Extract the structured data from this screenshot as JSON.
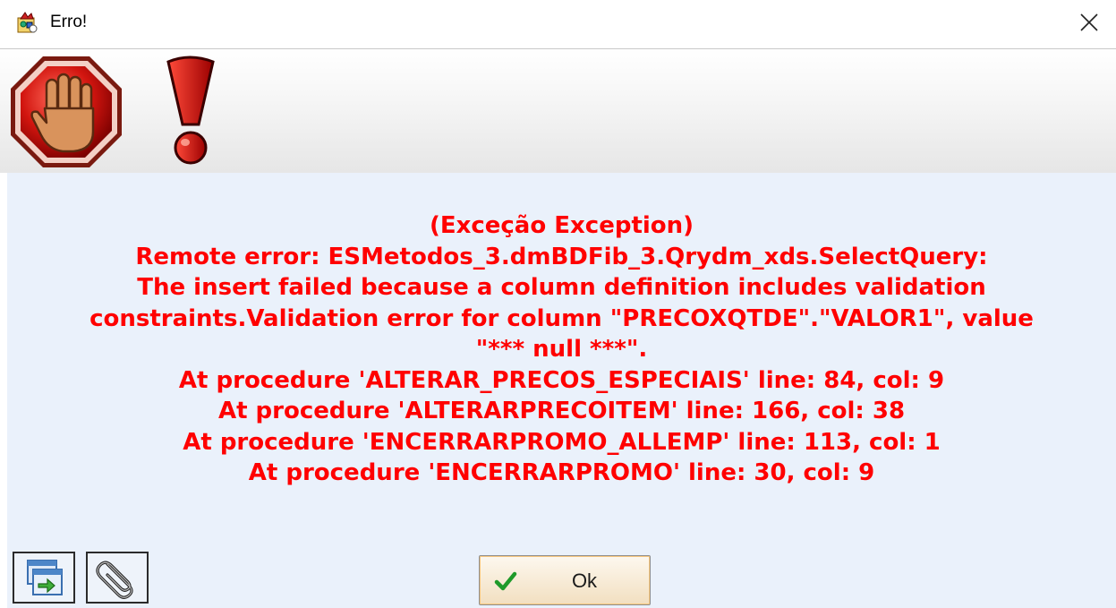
{
  "window": {
    "title": "Erro!",
    "close_icon": "close-icon"
  },
  "header": {
    "icons": [
      "stop-hand-icon",
      "exclamation-icon"
    ]
  },
  "message": {
    "color": "#ff0000",
    "lines": [
      "(Exceção Exception)",
      "Remote error: ESMetodos_3.dmBDFib_3.Qrydm_xds.SelectQuery:",
      "The insert failed because a column definition includes validation",
      "constraints.Validation error for column \"PRECOXQTDE\".\"VALOR1\", value",
      "\"*** null ***\".",
      "At procedure 'ALTERAR_PRECOS_ESPECIAIS' line: 84, col: 9",
      "At procedure 'ALTERARPRECOITEM' line: 166, col: 38",
      "At procedure 'ENCERRARPROMO_ALLEMP' line: 113, col: 1",
      "At procedure 'ENCERRARPROMO' line: 30, col: 9"
    ]
  },
  "footer": {
    "ok_label": "Ok",
    "tool_icons": [
      "copy-windows-icon",
      "paperclip-icon"
    ]
  }
}
